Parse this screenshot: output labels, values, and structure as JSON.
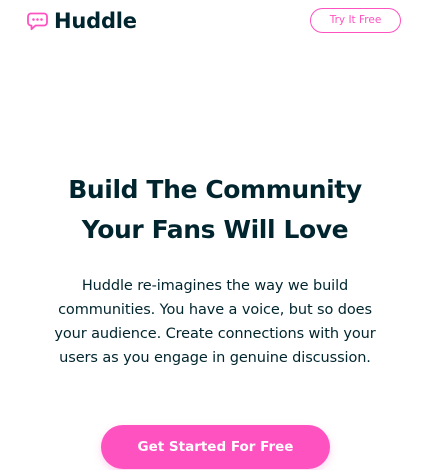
{
  "brand": {
    "name": "Huddle",
    "icon": "chat-bubble-icon",
    "accent_color": "#ff52c1",
    "text_color": "#00252e"
  },
  "header": {
    "cta_label": "Try It Free"
  },
  "hero": {
    "title_lines": [
      "Build The Community",
      "Your Fans Will Love"
    ],
    "description_lines": [
      "Huddle re-imagines the way we build",
      "communities. You have a voice, but so does",
      "your audience. Create connections with your",
      "users as you engage in genuine discussion."
    ],
    "cta_label": "Get Started For Free"
  }
}
